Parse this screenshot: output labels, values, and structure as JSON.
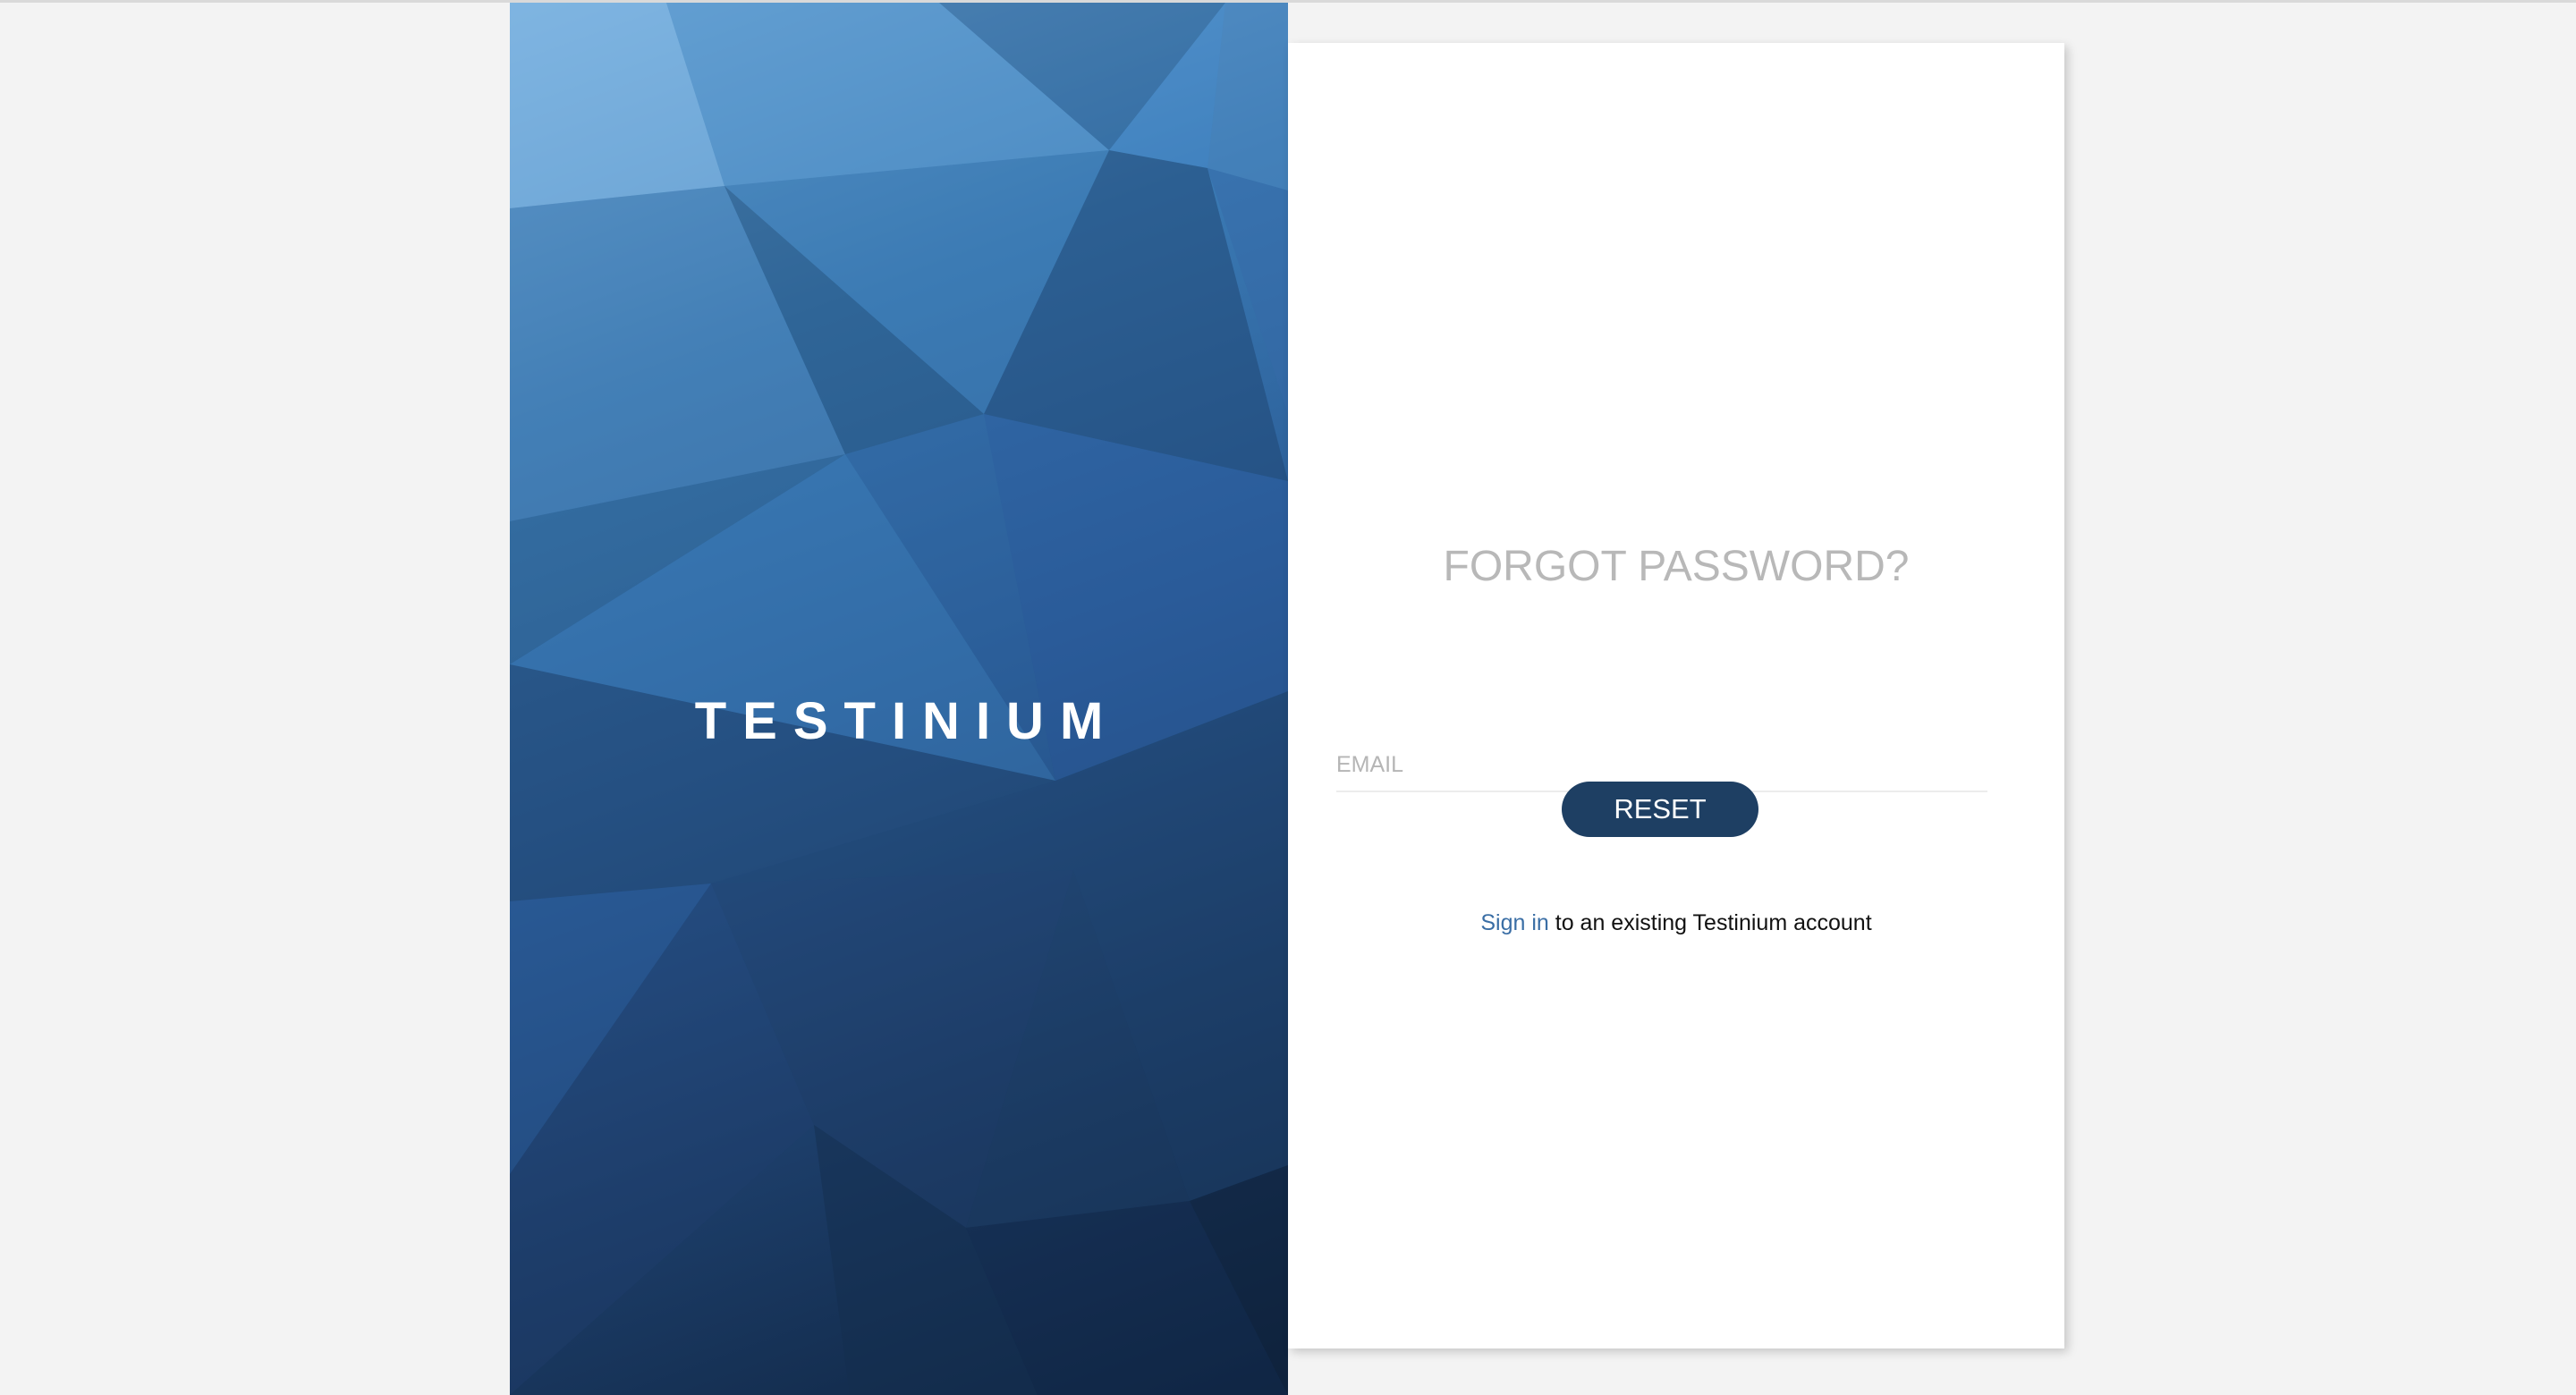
{
  "brand": {
    "name": "TESTINIUM"
  },
  "form": {
    "title": "FORGOT PASSWORD?",
    "email_placeholder": "EMAIL",
    "email_value": "",
    "reset_label": "RESET",
    "signin_link": "Sign in",
    "signin_suffix": " to an existing Testinium account"
  },
  "colors": {
    "button_bg": "#1e3f63",
    "link": "#3a6ea5",
    "title": "#b8b8b8",
    "page_bg": "#f3f3f3"
  }
}
